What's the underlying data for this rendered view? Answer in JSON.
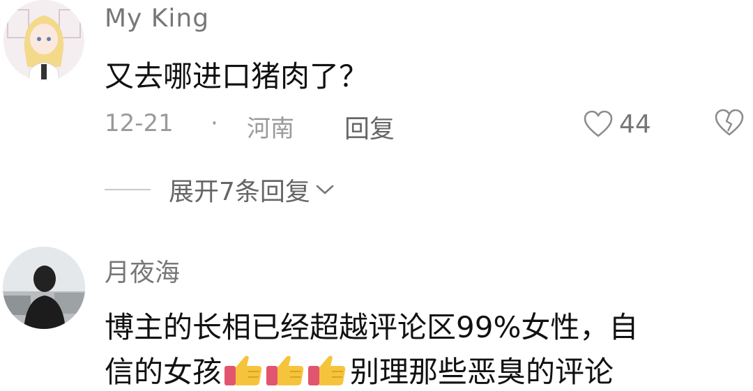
{
  "comments": [
    {
      "username": "My  King",
      "content": "又去哪进口猪肉了？",
      "date": "12-21",
      "separator": "·",
      "location": "河南",
      "reply_label": "回复",
      "like_count": "44",
      "expand_label": "展开7条回复",
      "avatar_icon": "anime-girl-avatar",
      "like_icon": "heart-outline-icon",
      "dislike_icon": "broken-heart-icon",
      "expand_icon": "chevron-down-icon"
    },
    {
      "username": "月夜海",
      "content_line1": "博主的长相已经超越评论区99%女性，自",
      "content_line2_before": "信的女孩",
      "content_line2_after": "别理那些恶臭的评论",
      "emoji": [
        "thumbs-up",
        "thumbs-up",
        "thumbs-up"
      ],
      "avatar_icon": "person-silhouette-avatar"
    }
  ],
  "colors": {
    "text_primary": "#111111",
    "text_secondary": "#777777",
    "text_meta": "#9a9a9a",
    "emoji_yellow": "#f6c43c",
    "emoji_cuff": "#e2556e"
  }
}
